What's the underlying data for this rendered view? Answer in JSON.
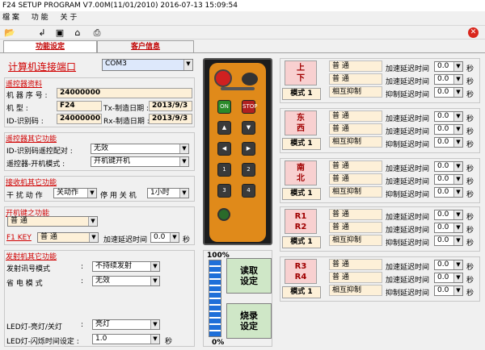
{
  "app": {
    "title": "F24 SETUP PROGRAM V7.00M(11/01/2010)  2016-07-13  15:09:54"
  },
  "menu": [
    "檔 案",
    "功 能",
    "关 于"
  ],
  "tabs": {
    "func": "功能设定",
    "cust": "客户信息"
  },
  "port": {
    "label": "计算机连接端口",
    "value": "COM3"
  },
  "receiver": {
    "section": "遥控器资料",
    "serial_label": "机 器 序 号 :",
    "serial": "24000000",
    "model_label": "机       型 :",
    "model": "F24",
    "tx_label": "Tx-制造日期 :",
    "tx_date": "2013/9/3",
    "id_label": "ID-识别码 :",
    "id": "24000000",
    "rx_label": "Rx-制造日期 :",
    "rx_date": "2013/9/3"
  },
  "other": {
    "section": "遥控器其它功能",
    "pair_label": "ID-识别码遥控配对 :",
    "pair": "无效",
    "mode_label": "遥控器-开机模式    :",
    "mode": "开机键开机"
  },
  "receiver_other": {
    "section": "接收机其它功能",
    "action_label": "干 扰 动 作",
    "action": "关动作",
    "stop_label": "停 用 关 机",
    "stop": "1小时"
  },
  "powerkey": {
    "section": "开机键之功能",
    "mode": "普      通",
    "f1_label": "F1 KEY",
    "f1": "普      通",
    "delay_label": "加速延迟时间",
    "delay": "0.0",
    "sec": "秒"
  },
  "transmitter": {
    "section": "发射机其它功能",
    "alarm_label": "发射讯号模式",
    "alarm": "不持续发射",
    "save_label": "省 电 模 式",
    "save": "无效",
    "led_label": "LED灯-亮灯/关灯",
    "led": "亮灯",
    "flash_label": "LED灯-闪烁时间设定 :",
    "flash": "1.0",
    "sec": "秒"
  },
  "progress": {
    "top": "100%",
    "bottom": "0%",
    "value": 0
  },
  "buttons": {
    "read": "读取\n设定",
    "write": "烧录\n设定"
  },
  "remote": {
    "keys": [
      "ON",
      "STOP",
      "",
      "",
      "1",
      "2",
      "3",
      "4"
    ]
  },
  "groups": [
    {
      "dir": "上\n下",
      "mode": "模式 1",
      "r1": "普      通",
      "r2": "普      通",
      "r3": "相互抑制"
    },
    {
      "dir": "东\n西",
      "mode": "模式 1",
      "r1": "普      通",
      "r2": "普      通",
      "r3": "相互抑制"
    },
    {
      "dir": "南\n北",
      "mode": "模式 1",
      "r1": "普      通",
      "r2": "普      通",
      "r3": "相互抑制"
    },
    {
      "dir": "R1\nR2",
      "mode": "模式 1",
      "r1": "普      通",
      "r2": "普      通",
      "r3": "相互抑制"
    },
    {
      "dir": "R3\nR4",
      "mode": "模式 1",
      "r1": "普      通",
      "r2": "普      通",
      "r3": "相互抑制"
    }
  ],
  "grp_labels": {
    "accel": "加速延迟时间",
    "suppress": "抑制延迟时间",
    "val": "0.0",
    "sec": "秒"
  }
}
